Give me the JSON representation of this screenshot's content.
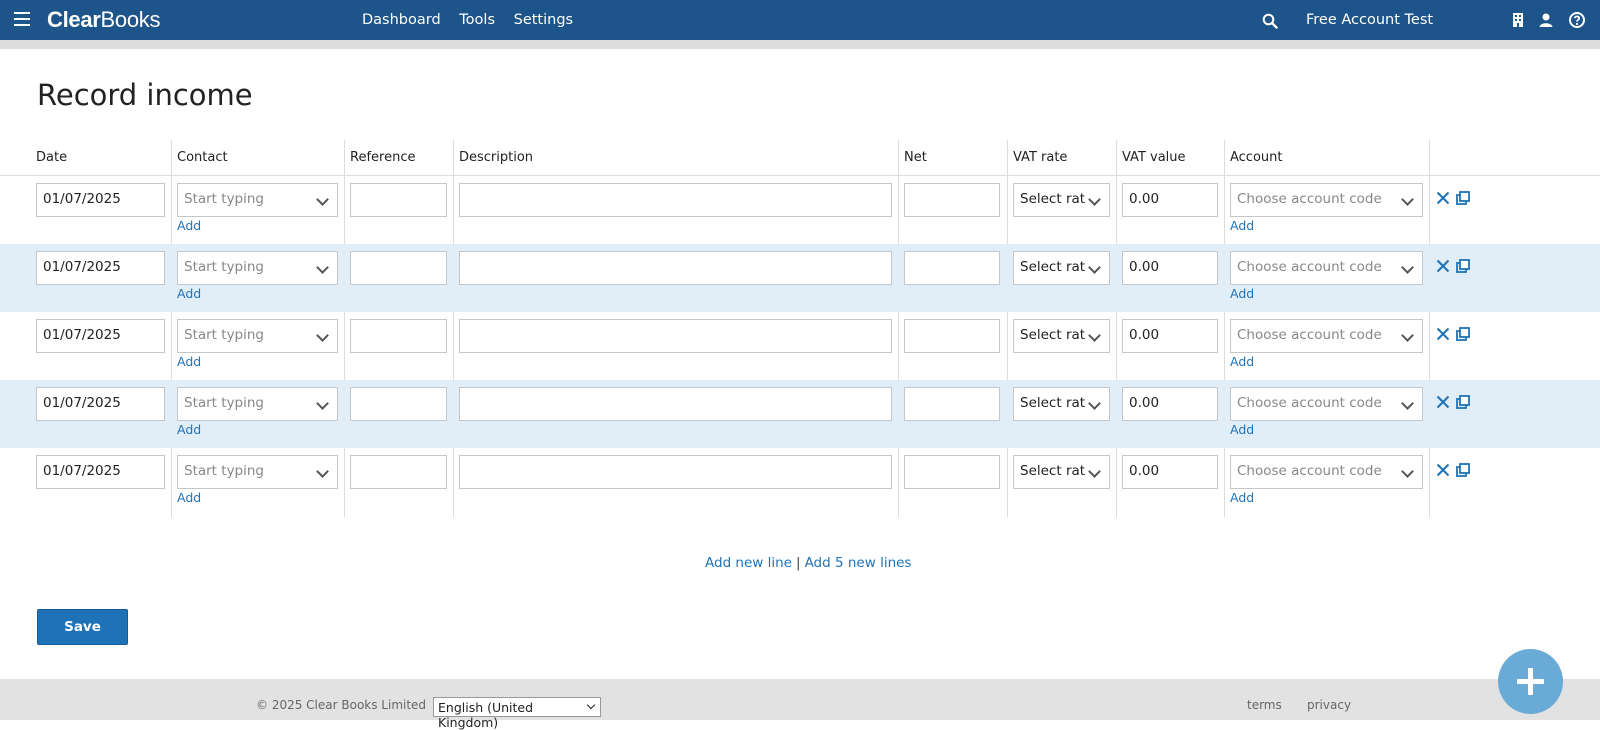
{
  "header": {
    "brand_bold": "Clear",
    "brand_light": "Books",
    "nav": [
      "Dashboard",
      "Tools",
      "Settings"
    ],
    "account_name": "Free Account Test",
    "color": "#1d5489"
  },
  "page": {
    "title": "Record income"
  },
  "table": {
    "columns": [
      "Date",
      "Contact",
      "Reference",
      "Description",
      "Net",
      "VAT rate",
      "VAT value",
      "Account"
    ],
    "rows": [
      {
        "date": "01/07/2025",
        "contact_placeholder": "Start typing",
        "contact_add": "Add",
        "reference": "",
        "description": "",
        "net": "",
        "vat_rate": "Select rat",
        "vat_value": "0.00",
        "account_placeholder": "Choose account code",
        "account_add": "Add"
      },
      {
        "date": "01/07/2025",
        "contact_placeholder": "Start typing",
        "contact_add": "Add",
        "reference": "",
        "description": "",
        "net": "",
        "vat_rate": "Select rat",
        "vat_value": "0.00",
        "account_placeholder": "Choose account code",
        "account_add": "Add"
      },
      {
        "date": "01/07/2025",
        "contact_placeholder": "Start typing",
        "contact_add": "Add",
        "reference": "",
        "description": "",
        "net": "",
        "vat_rate": "Select rat",
        "vat_value": "0.00",
        "account_placeholder": "Choose account code",
        "account_add": "Add"
      },
      {
        "date": "01/07/2025",
        "contact_placeholder": "Start typing",
        "contact_add": "Add",
        "reference": "",
        "description": "",
        "net": "",
        "vat_rate": "Select rat",
        "vat_value": "0.00",
        "account_placeholder": "Choose account code",
        "account_add": "Add"
      },
      {
        "date": "01/07/2025",
        "contact_placeholder": "Start typing",
        "contact_add": "Add",
        "reference": "",
        "description": "",
        "net": "",
        "vat_rate": "Select rat",
        "vat_value": "0.00",
        "account_placeholder": "Choose account code",
        "account_add": "Add"
      }
    ]
  },
  "actions": {
    "add_new_line": "Add new line",
    "separator": "|",
    "add_5_lines": "Add 5 new lines",
    "save": "Save"
  },
  "footer": {
    "copyright": "© 2025 Clear Books Limited",
    "language": "English (United Kingdom)",
    "terms": "terms",
    "privacy": "privacy"
  },
  "icons": {
    "menu": "menu-icon",
    "search": "search-icon",
    "building": "building-icon",
    "user": "user-icon",
    "help": "help-icon",
    "delete_row": "close-icon",
    "copy_row": "copy-icon",
    "fab": "plus-icon"
  },
  "colors": {
    "link": "#1f73b7",
    "row_alt": "#e1eef8",
    "fab": "#6aaad6",
    "save": "#1d72b8"
  }
}
